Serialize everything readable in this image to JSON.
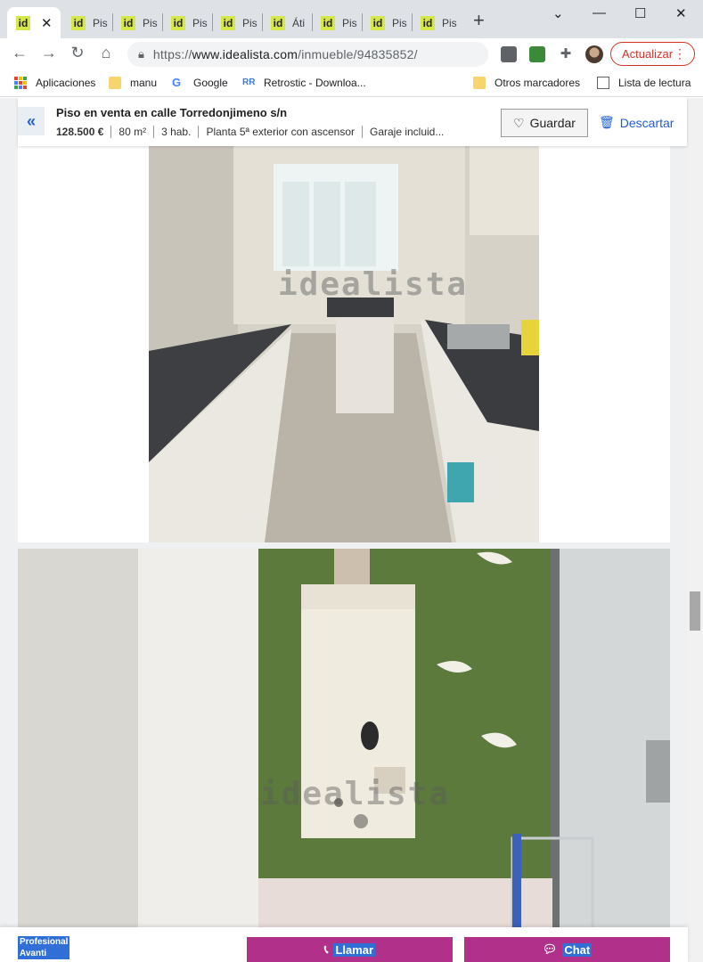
{
  "browser": {
    "tabs": [
      {
        "label": "",
        "active": true
      },
      {
        "label": "Pis",
        "active": false
      },
      {
        "label": "Pis",
        "active": false
      },
      {
        "label": "Pis",
        "active": false
      },
      {
        "label": "Pis",
        "active": false
      },
      {
        "label": "Áti",
        "active": false
      },
      {
        "label": "Pis",
        "active": false
      },
      {
        "label": "Pis",
        "active": false
      },
      {
        "label": "Pis",
        "active": false
      }
    ],
    "favicon_text": "id",
    "url_proto": "https://",
    "url_host": "www.idealista.com",
    "url_path": "/inmueble/94835852/",
    "update_label": "Actualizar"
  },
  "bookmarks": {
    "apps": "Aplicaciones",
    "manu": "manu",
    "google": "Google",
    "retrostic": "Retrostic - Downloa...",
    "others": "Otros marcadores",
    "reading_list": "Lista de lectura"
  },
  "listing": {
    "title": "Piso en venta en calle Torredonjimeno s/n",
    "price": "128.500 €",
    "area": "80 m²",
    "rooms": "3 hab.",
    "floor": "Planta 5ª exterior con ascensor",
    "garage": "Garaje incluid...",
    "save_label": "Guardar",
    "discard_label": "Descartar",
    "watermark": "idealista"
  },
  "footer": {
    "agency_line1": "Profesional",
    "agency_line2": "Avanti",
    "call_label": "Llamar",
    "chat_label": "Chat"
  },
  "colors": {
    "brand_blue": "#1c5ed6",
    "cta_magenta": "#b0308a",
    "favicon_yellow": "#d6e74a"
  }
}
